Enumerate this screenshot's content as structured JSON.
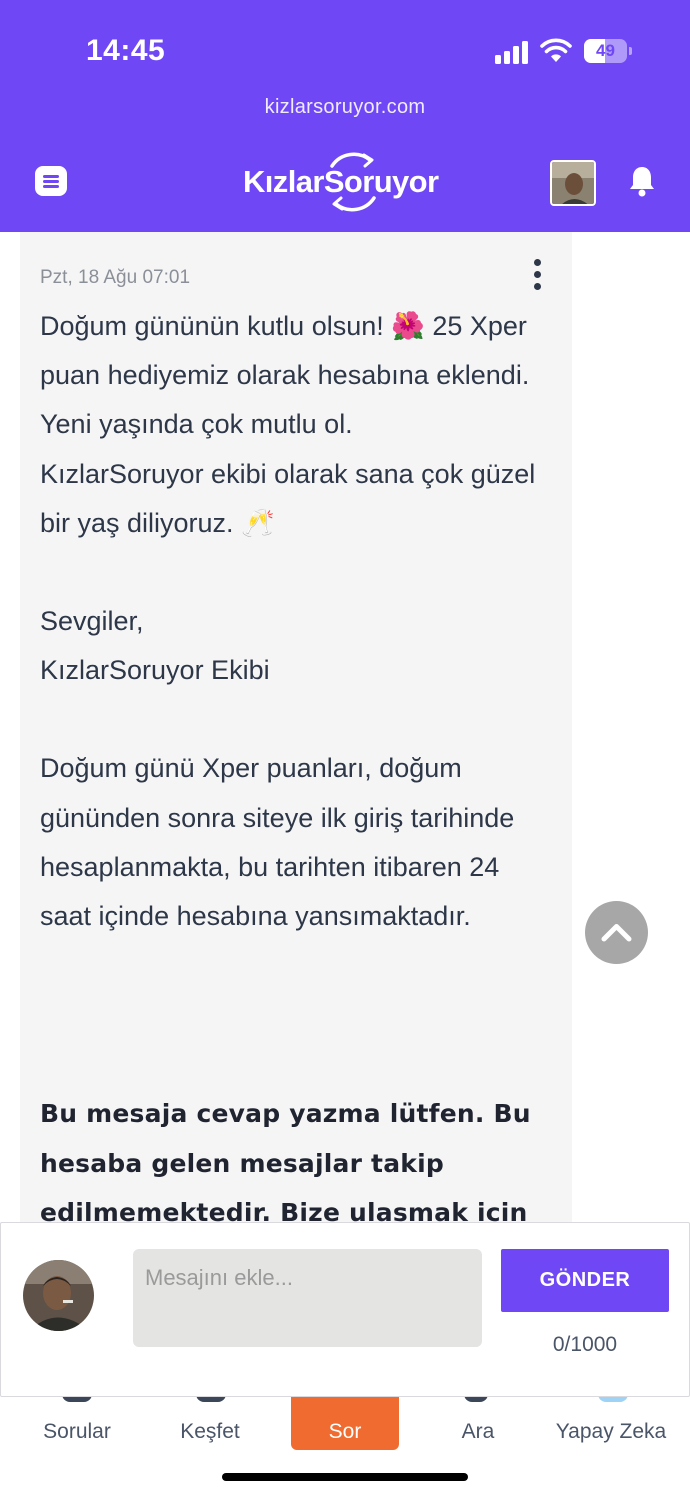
{
  "status_bar": {
    "time": "14:45",
    "battery_level": "49",
    "battery_fraction": 0.49
  },
  "header": {
    "url": "kizlarsoruyor.com",
    "logo_text": "KızlarSoruyor"
  },
  "message": {
    "date": "Pzt, 18 Ağu 07:01",
    "body_1": "Doğum gününün kutlu olsun! 🌺 25 Xper puan hediyemiz olarak hesabına eklendi.\nYeni yaşında çok mutlu ol.\nKızlarSoruyor ekibi olarak sana çok güzel bir yaş diliyoruz. 🥂",
    "body_2": "Sevgiler,\nKızlarSoruyor Ekibi",
    "body_3": "Doğum günü Xper puanları, doğum gününden sonra siteye ilk giriş tarihinde hesaplanmakta, bu tarihten itibaren 24 saat içinde hesabına yansımaktadır.",
    "notice": "Bu mesaja cevap yazma lütfen. Bu hesaba gelen mesajlar takip edilmemektedir. Bize ulasmak icin"
  },
  "composer": {
    "placeholder": "Mesajını ekle...",
    "value": "",
    "send_label": "GÖNDER",
    "char_count": "0/1000"
  },
  "bottom_nav": {
    "items": [
      {
        "label": "Sorular"
      },
      {
        "label": "Keşfet"
      },
      {
        "label": "Sor"
      },
      {
        "label": "Ara"
      },
      {
        "label": "Yapay Zeka"
      }
    ]
  },
  "colors": {
    "brand": "#6f47f5",
    "accent": "#ef6b2f",
    "card_bg": "#f5f5f6"
  }
}
